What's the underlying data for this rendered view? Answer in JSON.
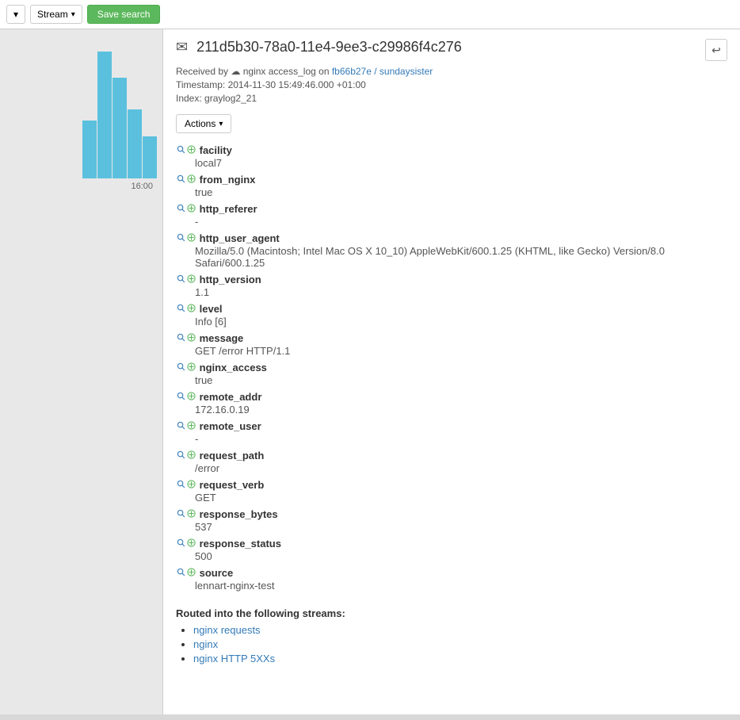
{
  "topbar": {
    "select_label": "▾",
    "stream_label": "Stream",
    "stream_caret": "▾",
    "save_search_label": "Save search"
  },
  "sidebar": {
    "chart": {
      "bars": [
        0,
        0,
        0,
        0,
        55,
        120,
        95,
        65,
        40,
        0
      ],
      "x_label": "16:00"
    }
  },
  "detail": {
    "envelope_icon": "✉",
    "message_id": "211d5b30-78a0-11e4-9ee3-c29986f4c276",
    "received_by_prefix": "Received by",
    "cloud_icon": "☁",
    "nginx_log": "nginx access_log",
    "on_text": "on",
    "stream_link_text": "fb66b27e / sundaysister",
    "stream_link_href": "#",
    "timestamp_label": "Timestamp:",
    "timestamp_value": "2014-11-30 15:49:46.000 +01:00",
    "index_label": "Index:",
    "index_value": "graylog2_21",
    "actions_label": "Actions",
    "actions_caret": "▾",
    "back_icon": "↩",
    "fields": [
      {
        "name": "facility",
        "value": "local7"
      },
      {
        "name": "from_nginx",
        "value": "true"
      },
      {
        "name": "http_referer",
        "value": "-"
      },
      {
        "name": "http_user_agent",
        "value": "Mozilla/5.0 (Macintosh; Intel Mac OS X 10_10) AppleWebKit/600.1.25 (KHTML, like Gecko) Version/8.0 Safari/600.1.25"
      },
      {
        "name": "http_version",
        "value": "1.1"
      },
      {
        "name": "level",
        "value": "Info [6]"
      },
      {
        "name": "message",
        "value": "GET /error HTTP/1.1"
      },
      {
        "name": "nginx_access",
        "value": "true"
      },
      {
        "name": "remote_addr",
        "value": "172.16.0.19"
      },
      {
        "name": "remote_user",
        "value": "-"
      },
      {
        "name": "request_path",
        "value": "/error"
      },
      {
        "name": "request_verb",
        "value": "GET"
      },
      {
        "name": "response_bytes",
        "value": "537"
      },
      {
        "name": "response_status",
        "value": "500"
      },
      {
        "name": "source",
        "value": "lennart-nginx-test"
      }
    ],
    "streams_title": "Routed into the following streams:",
    "streams": [
      {
        "label": "nginx requests",
        "href": "#"
      },
      {
        "label": "nginx",
        "href": "#"
      },
      {
        "label": "nginx HTTP 5XXs",
        "href": "#"
      }
    ]
  }
}
